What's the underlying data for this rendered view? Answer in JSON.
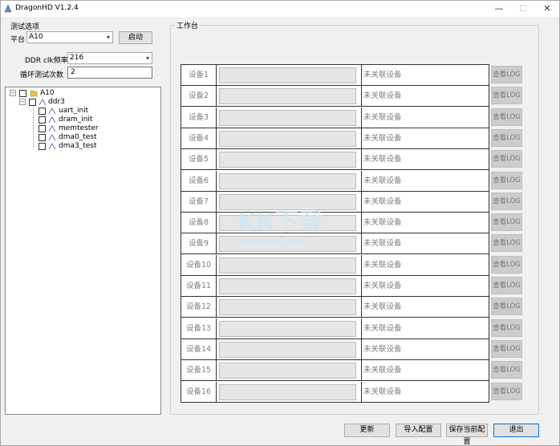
{
  "window": {
    "title": "DragonHD V1.2.4",
    "minimize": "—",
    "maximize": "☐",
    "close": "✕"
  },
  "options": {
    "group_label": "测试选项",
    "platform_label": "平台",
    "platform_value": "A10",
    "start_button": "启动",
    "ddr_label": "DDR clk频率",
    "ddr_value": "216",
    "loop_label": "循环测试次数",
    "loop_value": "2"
  },
  "tree": {
    "root": "A10",
    "group": "ddr3",
    "items": [
      "uart_init",
      "dram_init",
      "memtester",
      "dma0_test",
      "dma3_test"
    ]
  },
  "workbench": {
    "label": "工作台",
    "status_text": "未关联设备",
    "log_button": "查看LOG",
    "devices": [
      "设备1",
      "设备2",
      "设备3",
      "设备4",
      "设备5",
      "设备6",
      "设备7",
      "设备8",
      "设备9",
      "设备10",
      "设备11",
      "设备12",
      "设备13",
      "设备14",
      "设备15",
      "设备16"
    ]
  },
  "watermark": {
    "brand": "KK下载",
    "url": "www.kkx.net"
  },
  "buttons": {
    "refresh": "更新",
    "import": "导入配置",
    "save": "保存当前配置",
    "exit": "退出"
  },
  "colors": {
    "window_bg": "#f0f0f0",
    "table_border": "#333333",
    "status_gray": "#808080",
    "log_button_bg": "#cccccc",
    "accent": "#0078d7"
  }
}
